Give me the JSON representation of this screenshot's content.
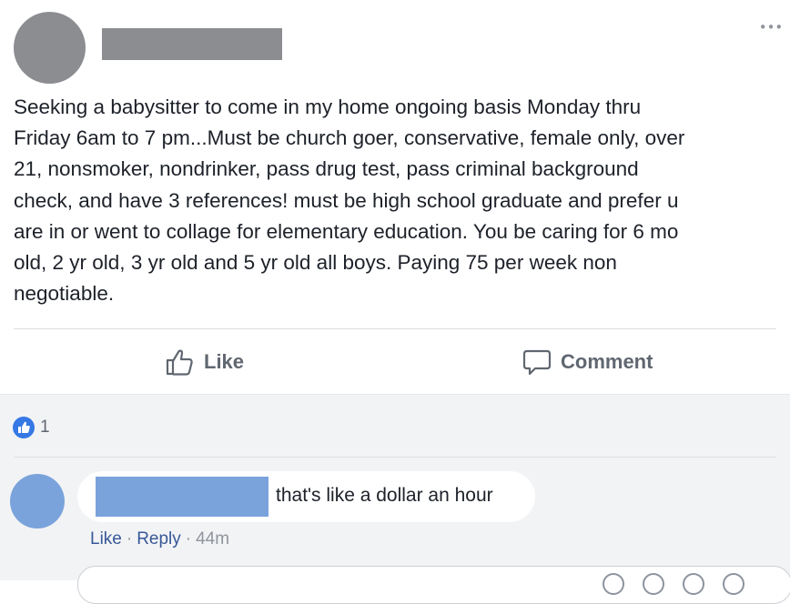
{
  "post": {
    "more_icon": "more-horizontal-icon",
    "more_glyph": "•••",
    "text": "Seeking a babysitter to come in my home ongoing basis Monday thru\nFriday 6am to 7 pm...Must be church goer, conservative, female only, over\n21, nonsmoker, nondrinker, pass drug test, pass criminal background\ncheck, and have 3 references! must be high school graduate and prefer u\nare in or went to collage for elementary education. You be caring for 6 mo\nold, 2 yr old, 3 yr old and 5 yr old all boys. Paying 75 per week non\nnegotiable."
  },
  "actions": {
    "like_label": "Like",
    "like_icon": "thumbs-up-icon",
    "comment_label": "Comment",
    "comment_icon": "speech-bubble-icon"
  },
  "reactions": {
    "icon": "like-reaction-icon",
    "count": "1"
  },
  "comment": {
    "text": "that's like a dollar an hour",
    "like_label": "Like",
    "reply_label": "Reply",
    "separator": "·",
    "time": "44m"
  },
  "colors": {
    "redaction_gray": "#8b8d91",
    "redaction_blue": "#7aa3dc",
    "link_blue": "#385898",
    "like_blue": "#3578e5"
  }
}
